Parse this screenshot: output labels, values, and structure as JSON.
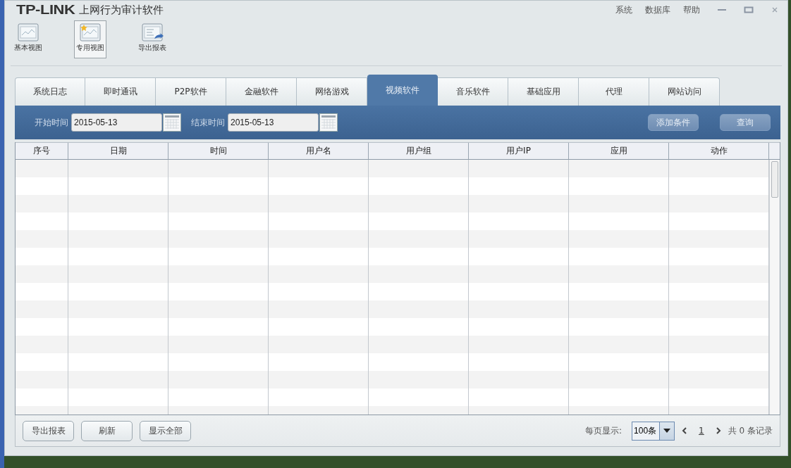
{
  "window": {
    "logo": "TP-LINK",
    "title": "上网行为审计软件",
    "menu": [
      "系统",
      "数据库",
      "帮助"
    ]
  },
  "toolbar": [
    {
      "label": "基本视图",
      "selected": false
    },
    {
      "label": "专用视图",
      "selected": true
    },
    {
      "label": "导出报表",
      "selected": false
    }
  ],
  "tabs": [
    {
      "label": "系统日志",
      "selected": false
    },
    {
      "label": "即时通讯",
      "selected": false
    },
    {
      "label": "P2P软件",
      "selected": false
    },
    {
      "label": "金融软件",
      "selected": false
    },
    {
      "label": "网络游戏",
      "selected": false
    },
    {
      "label": "视频软件",
      "selected": true
    },
    {
      "label": "音乐软件",
      "selected": false
    },
    {
      "label": "基础应用",
      "selected": false
    },
    {
      "label": "代理",
      "selected": false
    },
    {
      "label": "网站访问",
      "selected": false
    }
  ],
  "filter": {
    "start_label": "开始时间",
    "start_value": "2015-05-13",
    "end_label": "结束时间",
    "end_value": "2015-05-13",
    "buttons": [
      "添加条件",
      "查询"
    ]
  },
  "table": {
    "columns": [
      "序号",
      "日期",
      "时间",
      "用户名",
      "用户组",
      "用户IP",
      "应用",
      "动作"
    ]
  },
  "footer": {
    "buttons": [
      "导出报表",
      "刷新",
      "显示全部"
    ],
    "page_size_label": "每页显示:",
    "page_size": "100条",
    "page": "1",
    "total": "共 0 条记录"
  }
}
